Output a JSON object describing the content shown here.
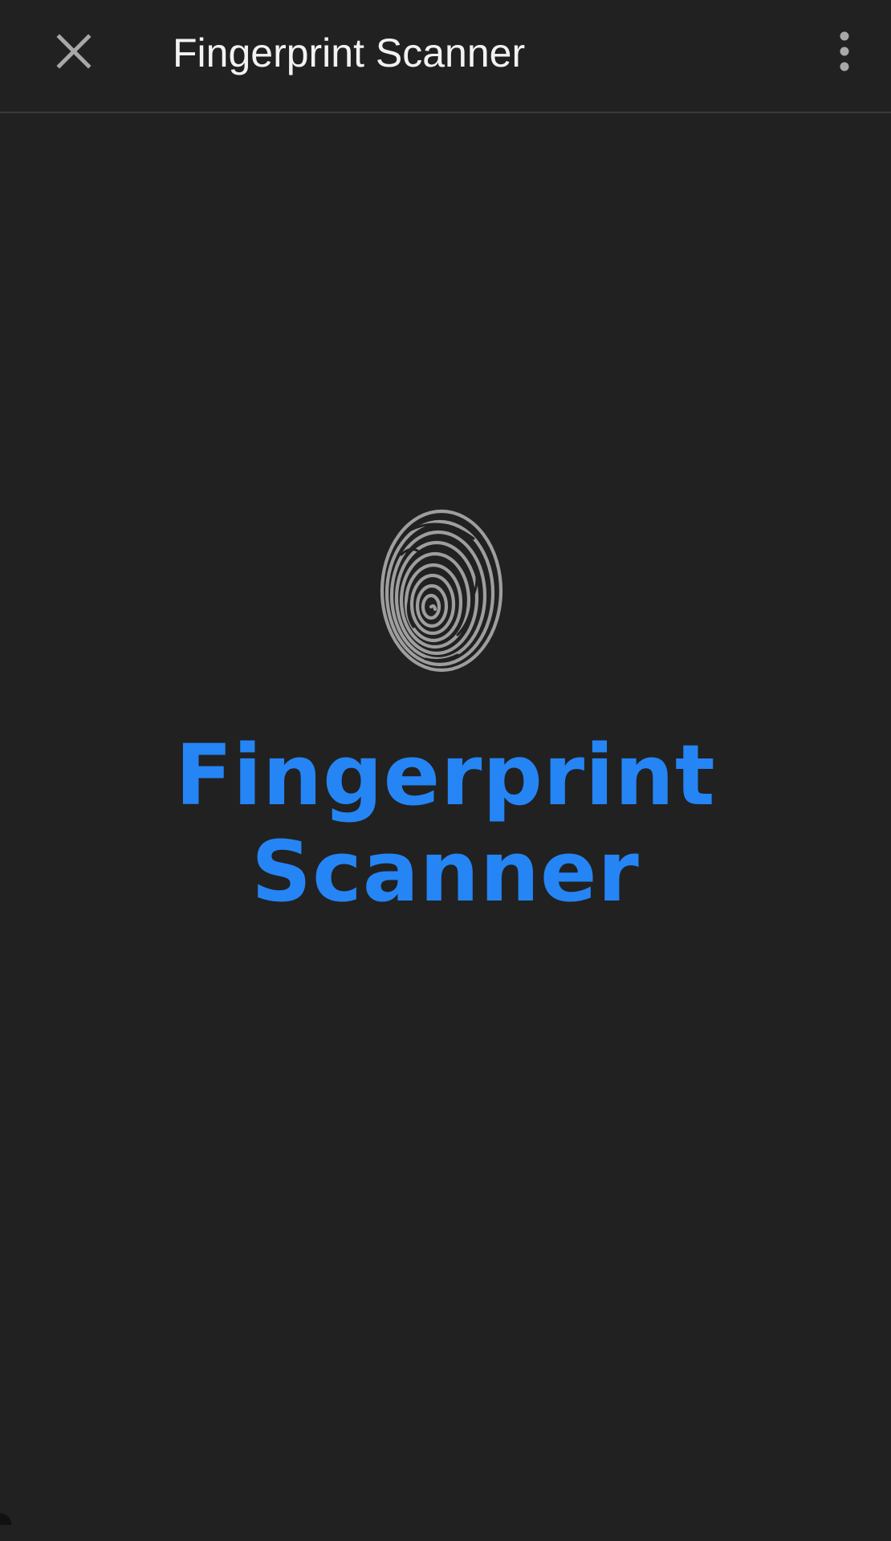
{
  "top_bar": {
    "title": "Fingerprint Scanner",
    "close_icon": "close-icon",
    "menu_icon": "more-vert-icon"
  },
  "splash": {
    "logo_icon": "fingerprint-icon",
    "app_name_line1": "Fingerprint",
    "app_name_line2": "Scanner"
  },
  "colors": {
    "background": "#212121",
    "accent": "#2585f5",
    "icon_gray": "#9e9e9e"
  }
}
